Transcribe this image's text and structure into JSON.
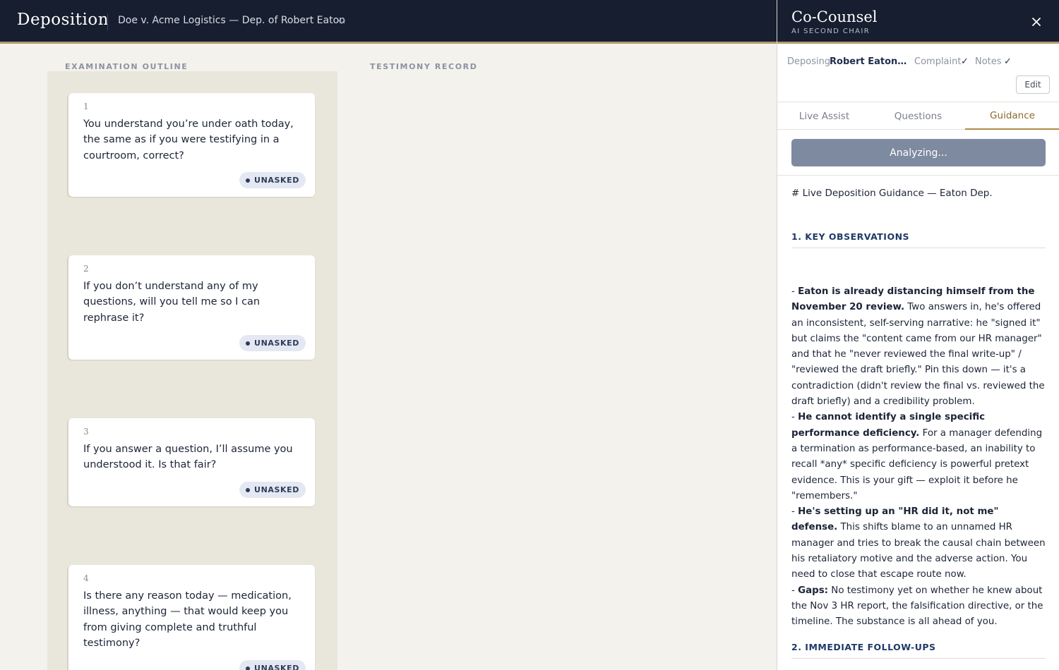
{
  "app": {
    "brand": "Deposition",
    "case_title": "Doe v. Acme Logistics — Dep. of Robert Eaton"
  },
  "columns": {
    "outline_label": "EXAMINATION OUTLINE",
    "testimony_label": "TESTIMONY RECORD"
  },
  "questions": [
    {
      "num": "1",
      "text": "You understand you’re under oath today, the same as if you were testifying in a courtroom, correct?",
      "status": "UNASKED"
    },
    {
      "num": "2",
      "text": "If you don’t understand any of my questions, will you tell me so I can rephrase it?",
      "status": "UNASKED"
    },
    {
      "num": "3",
      "text": "If you answer a question, I’ll assume you understood it. Is that fair?",
      "status": "UNASKED"
    },
    {
      "num": "4",
      "text": "Is there any reason today — medication, illness, anything — that would keep you from giving complete and truthful testimony?",
      "status": "UNASKED"
    }
  ],
  "panel": {
    "title": "Co-Counsel",
    "subtitle": "AI SECOND CHAIR",
    "context": {
      "deposing_label": "Deposing",
      "deposing_value": "Robert Eaton, Director of Operations",
      "complaint_label": "Complaint",
      "notes_label": "Notes",
      "check_mark": "✓"
    },
    "edit_label": "Edit",
    "tabs": [
      "Live Assist",
      "Questions",
      "Guidance"
    ],
    "active_tab": "Guidance",
    "analyze_label": "Analyzing...",
    "guidance": {
      "heading": "# Live Deposition Guidance — Eaton Dep.",
      "section1": "1. KEY OBSERVATIONS",
      "bullets": [
        {
          "bold": "Eaton is already distancing himself from the November 20 review.",
          "text": " Two answers in, he's offered an inconsistent, self-serving narrative: he \"signed it\" but claims the \"content came from our HR manager\" and that he \"never reviewed the final write-up\" / \"reviewed the draft briefly.\" Pin this down — it's a contradiction (didn't review the final vs. reviewed the draft briefly) and a credibility problem."
        },
        {
          "bold": "He cannot identify a single specific performance deficiency.",
          "text": " For a manager defending a termination as performance-based, an inability to recall *any* specific deficiency is powerful pretext evidence. This is your gift — exploit it before he \"remembers.\""
        },
        {
          "bold": "He's setting up an \"HR did it, not me\" defense.",
          "text": " This shifts blame to an unnamed HR manager and tries to break the causal chain between his retaliatory motive and the adverse action. You need to close that escape route now."
        },
        {
          "bold": "Gaps:",
          "text": " No testimony yet on whether he knew about the Nov 3 HR report, the falsification directive, or the timeline. The substance is all ahead of you."
        }
      ],
      "section2": "2. IMMEDIATE FOLLOW-UPS"
    }
  }
}
